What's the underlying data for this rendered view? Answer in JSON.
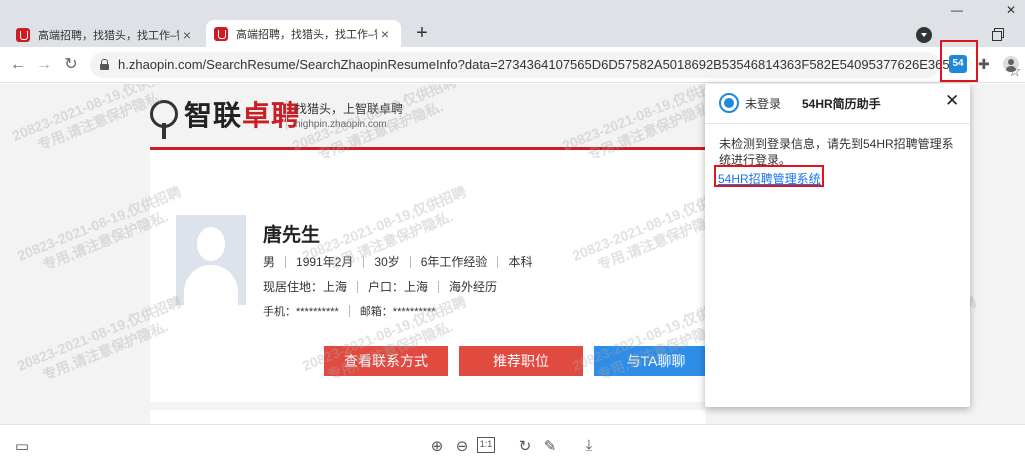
{
  "browser": {
    "tabs": [
      {
        "title": "高端招聘，找猎头，找工作–智联",
        "active": false
      },
      {
        "title": "高端招聘，找猎头，找工作–智联",
        "active": true
      }
    ],
    "url": "h.zhaopin.com/SearchResume/SearchZhaopinResumeInfo?data=2734364107565D6D57582A5018692B53546814363F582E54095377626E365...",
    "extension_badge": "54",
    "icons": {
      "new_tab": "+",
      "back": "←",
      "forward": "→",
      "reload": "↻",
      "star": "☆",
      "puzzle": "✚",
      "minimize": "—",
      "close": "✕",
      "tab_close": "×"
    }
  },
  "page": {
    "logo_prefix": "智联",
    "logo_red": "卓聘",
    "slogan": "找猎头，上智联卓聘",
    "slogan_url": "highpin.zhaopin.com",
    "watermark_line1": "20823-2021-08-19,仅供招聘",
    "watermark_line2": "专用,请注意保护隐私.",
    "profile": {
      "name": "唐先生",
      "gender": "男",
      "birth": "1991年2月",
      "age": "30岁",
      "experience": "6年工作经验",
      "education": "本科",
      "residence": "现居住地：上海",
      "hukou": "户口：上海",
      "overseas": "海外经历",
      "phone": "手机：**********",
      "email": "邮箱：**********"
    },
    "buttons": {
      "contact": "查看联系方式",
      "recommend": "推荐职位",
      "chat": "与TA聊聊"
    }
  },
  "popup": {
    "status": "未登录",
    "title": "54HR简历助手",
    "close": "✕",
    "message": "未检测到登录信息，请先到54HR招聘管理系统进行登录。",
    "link": "54HR招聘管理系统"
  },
  "bottom_bar": {
    "fit_label": "1:1",
    "icons": {
      "sidebar": "▭",
      "zoom_in": "⊕",
      "zoom_out": "⊖",
      "rotate": "↻",
      "draw": "✎",
      "download": "⤓"
    }
  }
}
